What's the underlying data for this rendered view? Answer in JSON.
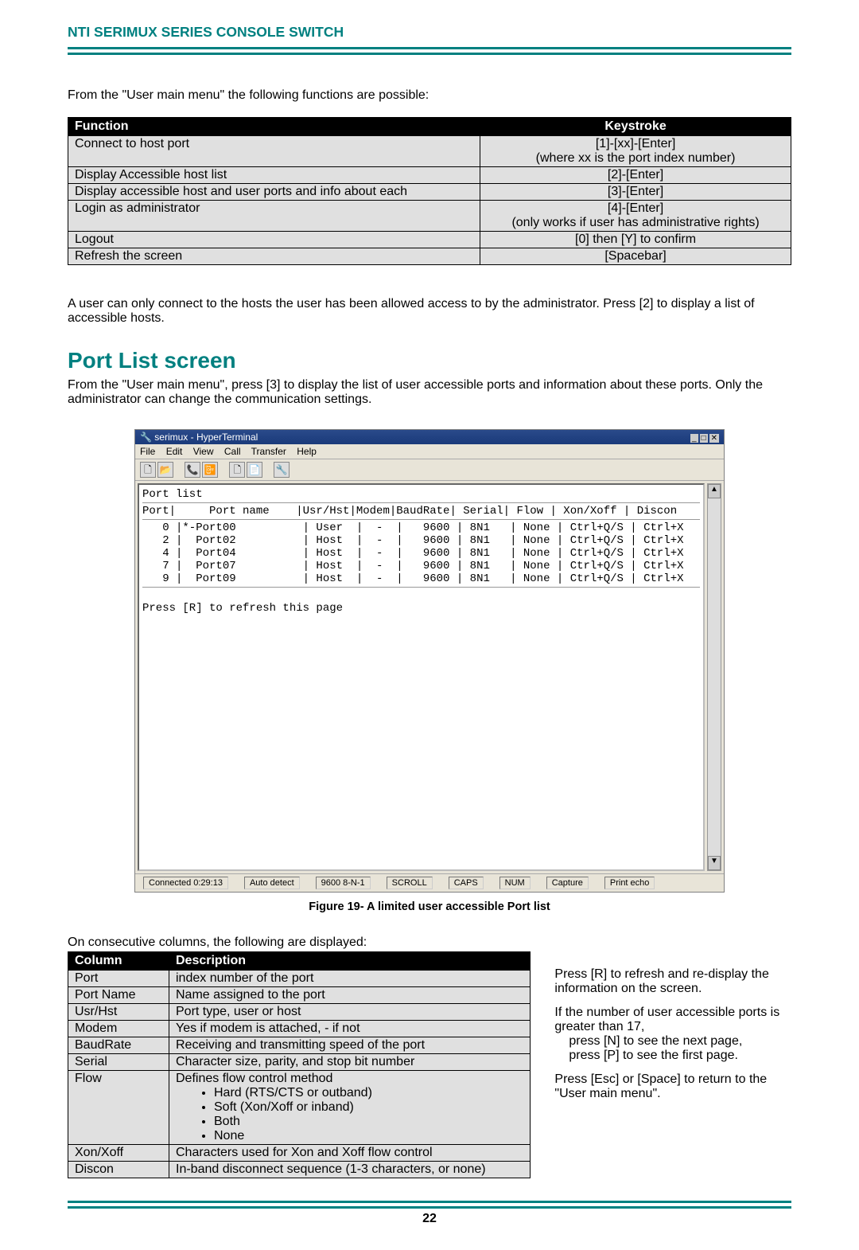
{
  "doc_header": "NTI SERIMUX SERIES CONSOLE SWITCH",
  "intro": "From the \"User main menu\" the following functions are possible:",
  "func_headers": {
    "col1": "Function",
    "col2": "Keystroke"
  },
  "func_rows": [
    {
      "fn": "Connect to host port",
      "ks": "[1]-[xx]-[Enter]\n(where xx is the port index number)"
    },
    {
      "fn": "Display Accessible host list",
      "ks": "[2]-[Enter]"
    },
    {
      "fn": "Display accessible host and user ports and info about each",
      "ks": "[3]-[Enter]"
    },
    {
      "fn": "Login as administrator",
      "ks": "[4]-[Enter]\n(only works if user has administrative rights)"
    },
    {
      "fn": "Logout",
      "ks": "[0]  then [Y] to confirm"
    },
    {
      "fn": "Refresh the screen",
      "ks": "[Spacebar]"
    }
  ],
  "access_para": "A user can only connect to the hosts the user has been allowed access to by the administrator.   Press [2] to display a list of accessible hosts.",
  "section_title": "Port List screen",
  "section_para": "From the \"User main menu\", press [3] to display the list of user accessible ports and information about these ports. Only the administrator can change the communication settings.",
  "ht": {
    "title": "serimux - HyperTerminal",
    "menu": {
      "file": "File",
      "edit": "Edit",
      "view": "View",
      "call": "Call",
      "transfer": "Transfer",
      "help": "Help"
    },
    "status": {
      "conn": "Connected 0:29:13",
      "detect": "Auto detect",
      "baud": "9600 8-N-1",
      "scroll": "SCROLL",
      "caps": "CAPS",
      "num": "NUM",
      "capture": "Capture",
      "echo": "Print echo"
    },
    "body1": "Port list",
    "body2": "Port|     Port name    |Usr/Hst|Modem|BaudRate| Serial| Flow | Xon/Xoff | Discon",
    "rows": [
      "   0 |*-Port00          | User  |  -  |   9600 | 8N1   | None | Ctrl+Q/S | Ctrl+X",
      "   2 |  Port02          | Host  |  -  |   9600 | 8N1   | None | Ctrl+Q/S | Ctrl+X",
      "   4 |  Port04          | Host  |  -  |   9600 | 8N1   | None | Ctrl+Q/S | Ctrl+X",
      "   7 |  Port07          | Host  |  -  |   9600 | 8N1   | None | Ctrl+Q/S | Ctrl+X",
      "   9 |  Port09          | Host  |  -  |   9600 | 8N1   | None | Ctrl+Q/S | Ctrl+X"
    ],
    "body3": "Press [R] to refresh this page"
  },
  "fig_caption": "Figure 19- A limited user accessible Port list",
  "cols_intro": "On consecutive columns, the following are displayed:",
  "col_headers": {
    "c1": "Column",
    "c2": "Description"
  },
  "col_rows": [
    {
      "c": "Port",
      "d": "index number of the port"
    },
    {
      "c": "Port Name",
      "d": "Name assigned to the port"
    },
    {
      "c": "Usr/Hst",
      "d": "Port type, user or host"
    },
    {
      "c": "Modem",
      "d": "Yes if modem is attached,  -  if not"
    },
    {
      "c": "BaudRate",
      "d": "Receiving and transmitting speed of the port"
    },
    {
      "c": "Serial",
      "d": "Character size,  parity, and stop bit number"
    }
  ],
  "flow_label": "Flow",
  "flow_desc": "Defines flow control method",
  "flow_bullets": [
    "Hard (RTS/CTS or outband)",
    "Soft (Xon/Xoff or inband)",
    "Both",
    "None"
  ],
  "col_rows2": [
    {
      "c": "Xon/Xoff",
      "d": "Characters used for Xon and Xoff flow control"
    },
    {
      "c": "Discon",
      "d": "In-band disconnect sequence (1-3 characters, or none)"
    }
  ],
  "side": {
    "p1": "Press [R] to refresh and re-display the information on the screen.",
    "p2": "If the number of user accessible ports is greater than 17,",
    "p2a": "press [N] to see the next page,",
    "p2b": "press [P] to see the first page.",
    "p3": "Press [Esc] or [Space] to return to the \"User main menu\"."
  },
  "page_number": "22"
}
